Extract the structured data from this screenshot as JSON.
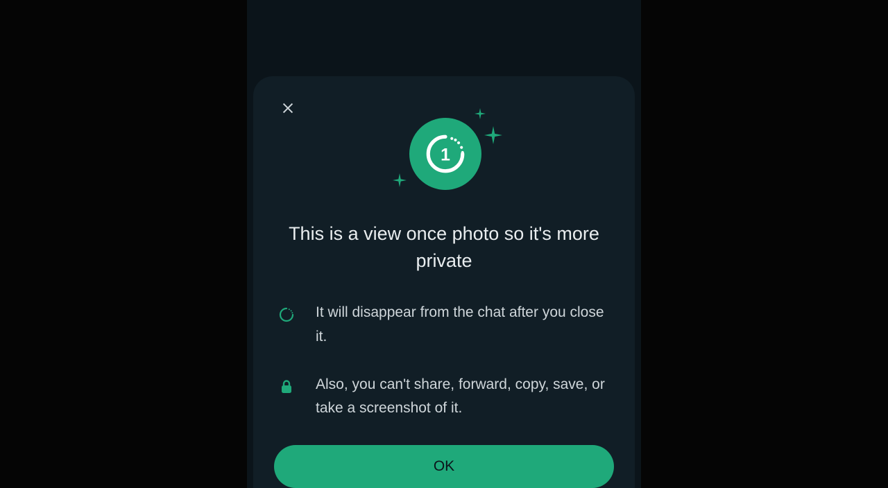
{
  "dialog": {
    "title": "This is a view once photo so it's more private",
    "bullets": [
      {
        "icon": "disappearing-circle-icon",
        "text": "It will disappear from the chat after you close it."
      },
      {
        "icon": "lock-icon",
        "text": "Also, you can't share, forward, copy, save, or take a screenshot of it."
      }
    ],
    "ok_label": "OK"
  },
  "colors": {
    "accent": "#1fa97a",
    "panel": "#111e26",
    "text_primary": "#e9edef",
    "text_secondary": "#cfd6da"
  }
}
